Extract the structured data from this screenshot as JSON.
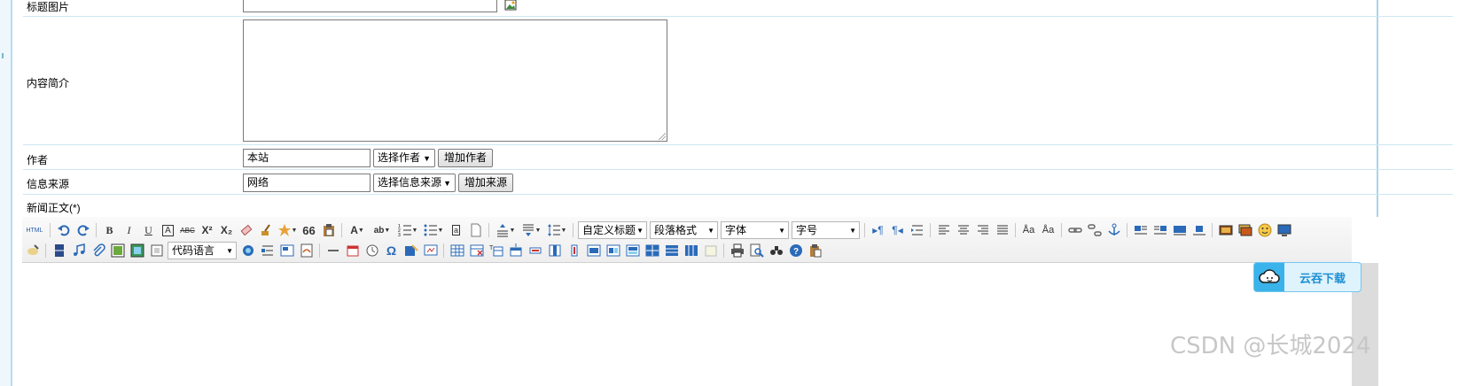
{
  "form": {
    "title_image": {
      "label": "标题图片",
      "value": ""
    },
    "summary": {
      "label": "内容简介",
      "value": ""
    },
    "author": {
      "label": "作者",
      "value": "本站",
      "select": "选择作者",
      "add_button": "增加作者"
    },
    "source": {
      "label": "信息来源",
      "value": "网络",
      "select": "选择信息来源",
      "add_button": "增加来源"
    },
    "body": {
      "label": "新闻正文(*)"
    }
  },
  "editor": {
    "toolbar": {
      "html_label": "HTML",
      "custom_heading": "自定义标题",
      "paragraph_format": "段落格式",
      "font_family": "字体",
      "font_size": "字号",
      "code_language": "代码语言",
      "omega": "Ω",
      "quote": "66"
    }
  },
  "overlay": {
    "download_label": "云吞下载",
    "watermark": "CSDN @长城2024"
  },
  "colors": {
    "border": "#a9d4ea",
    "accent": "#3ab3ea",
    "download_text": "#1e8fd2"
  }
}
